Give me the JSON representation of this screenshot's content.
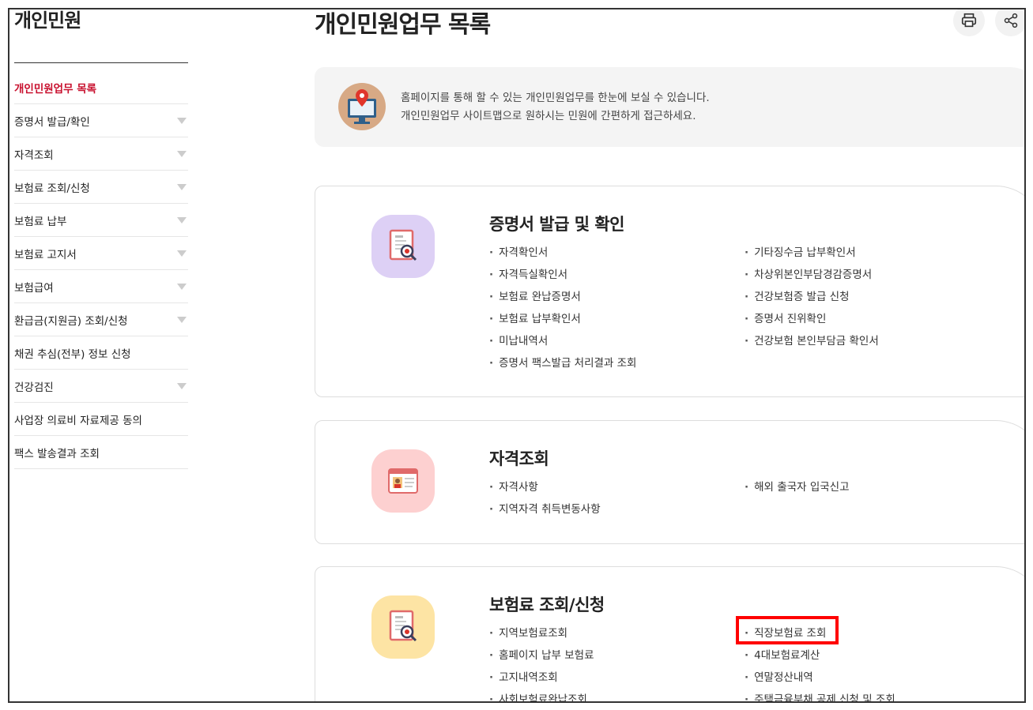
{
  "sidebar": {
    "title": "개인민원",
    "items": [
      {
        "label": "개인민원업무 목록",
        "active": true,
        "expandable": false
      },
      {
        "label": "증명서 발급/확인",
        "active": false,
        "expandable": true
      },
      {
        "label": "자격조회",
        "active": false,
        "expandable": true
      },
      {
        "label": "보험료 조회/신청",
        "active": false,
        "expandable": true
      },
      {
        "label": "보험료 납부",
        "active": false,
        "expandable": true
      },
      {
        "label": "보험료 고지서",
        "active": false,
        "expandable": true
      },
      {
        "label": "보험급여",
        "active": false,
        "expandable": true
      },
      {
        "label": "환급금(지원금) 조회/신청",
        "active": false,
        "expandable": true
      },
      {
        "label": "채권 추심(전부) 정보 신청",
        "active": false,
        "expandable": false
      },
      {
        "label": "건강검진",
        "active": false,
        "expandable": true
      },
      {
        "label": "사업장 의료비 자료제공 동의",
        "active": false,
        "expandable": false
      },
      {
        "label": "팩스 발송결과 조회",
        "active": false,
        "expandable": false
      }
    ]
  },
  "header": {
    "title": "개인민원업무 목록",
    "print_icon": "printer-icon",
    "share_icon": "share-icon"
  },
  "info": {
    "line1": "홈페이지를 통해 할 수 있는 개인민원업무를 한눈에 보실 수 있습니다.",
    "line2": "개인민원업무 사이트맵으로 원하시는 민원에 간편하게 접근하세요."
  },
  "cards": [
    {
      "title": "증명서 발급 및 확인",
      "icon": "document-search-icon",
      "icon_bg": "#ddd0f5",
      "left": [
        "자격확인서",
        "자격득실확인서",
        "보험료 완납증명서",
        "보험료 납부확인서",
        "미납내역서",
        "증명서 팩스발급 처리결과 조회"
      ],
      "right": [
        "기타징수금 납부확인서",
        "차상위본인부담경감증명서",
        "건강보험증 발급 신청",
        "증명서 진위확인",
        "건강보험 본인부담금 확인서"
      ]
    },
    {
      "title": "자격조회",
      "icon": "id-card-icon",
      "icon_bg": "#fdd0d0",
      "left": [
        "자격사항",
        "지역자격 취득변동사항"
      ],
      "right": [
        "해외 출국자 입국신고"
      ]
    },
    {
      "title": "보험료 조회/신청",
      "icon": "document-search-icon",
      "icon_bg": "#fde4a4",
      "left": [
        "지역보험료조회",
        "홈페이지 납부 보험료",
        "고지내역조회",
        "사회보험료완납조회"
      ],
      "right": [
        "직장보험료 조회",
        "4대보험료계산",
        "연말정산내역",
        "주택금융부채 공제 신청 및 조회"
      ],
      "highlighted": "직장보험료 조회"
    }
  ],
  "colors": {
    "accent": "#c8102e",
    "highlight": "#ff0000"
  }
}
